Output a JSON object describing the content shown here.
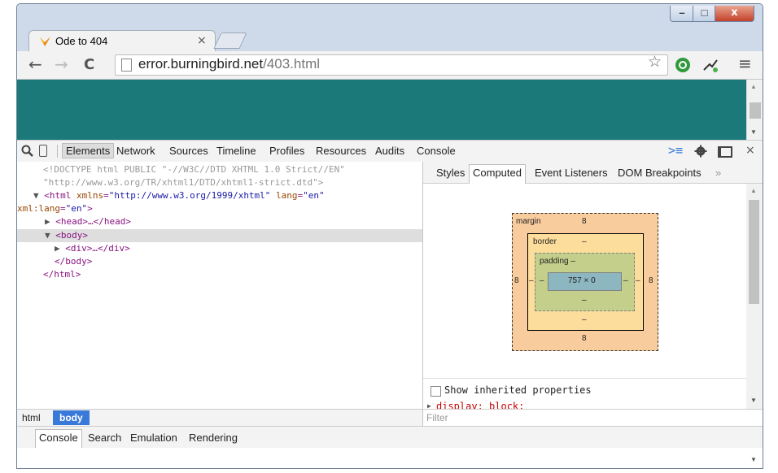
{
  "window": {
    "tab_title": "Ode to 404",
    "tab_close": "×",
    "controls": {
      "minimize": "–",
      "maximize": "□",
      "close": "x"
    }
  },
  "toolbar": {
    "back": "←",
    "forward": "→",
    "reload": "C",
    "url_host": "error.burningbird.net",
    "url_path": "/403.html",
    "bookmark": "☆",
    "menu": "≡"
  },
  "devtools": {
    "tabs": [
      "Elements",
      "Network",
      "Sources",
      "Timeline",
      "Profiles",
      "Resources",
      "Audits",
      "Console"
    ],
    "active_tab": "Elements",
    "close": "×"
  },
  "elements": {
    "doctype_line1": "<!DOCTYPE html PUBLIC \"-//W3C//DTD XHTML 1.0 Strict//EN\"",
    "doctype_line2": "\"http://www.w3.org/TR/xhtml1/DTD/xhtml1-strict.dtd\">",
    "html_open_a": "<html",
    "html_attr1": "xmlns",
    "html_val1": "\"http://www.w3.org/1999/xhtml\"",
    "html_attr2": "lang",
    "html_val2": "\"en\"",
    "html_attr3": "xml:lang",
    "html_val3": "\"en\"",
    "html_close_bracket": ">",
    "head": "<head>…</head>",
    "body_open": "<body>",
    "div": "<div>…</div>",
    "body_close": "</body>",
    "html_close": "</html>"
  },
  "side": {
    "tabs": [
      "Styles",
      "Computed",
      "Event Listeners",
      "DOM Breakpoints"
    ],
    "active_tab": "Computed",
    "more": "»"
  },
  "box_model": {
    "margin_label": "margin",
    "margin_top": "8",
    "margin_bottom": "8",
    "margin_left": "8",
    "margin_right": "8",
    "border_label": "border",
    "border_top": "–",
    "border_bottom": "–",
    "border_left": "–",
    "border_right": "–",
    "padding_label": "padding –",
    "padding_bottom": "–",
    "padding_left": "–",
    "padding_right": "–",
    "content": "757 × 0"
  },
  "computed": {
    "show_inherited": "Show inherited properties",
    "first_prop": "display: block;"
  },
  "breadcrumbs": [
    "html",
    "body"
  ],
  "active_crumb": "body",
  "filter_placeholder": "Filter",
  "drawer": {
    "tabs": [
      "Console",
      "Search",
      "Emulation",
      "Rendering"
    ],
    "active_tab": "Console"
  },
  "colors": {
    "page_bg": "#1b7a79",
    "crumb_selected": "#3879d9",
    "margin": "#f9cc9d",
    "padding": "#c3cf8a",
    "content": "#8cb6c0"
  }
}
